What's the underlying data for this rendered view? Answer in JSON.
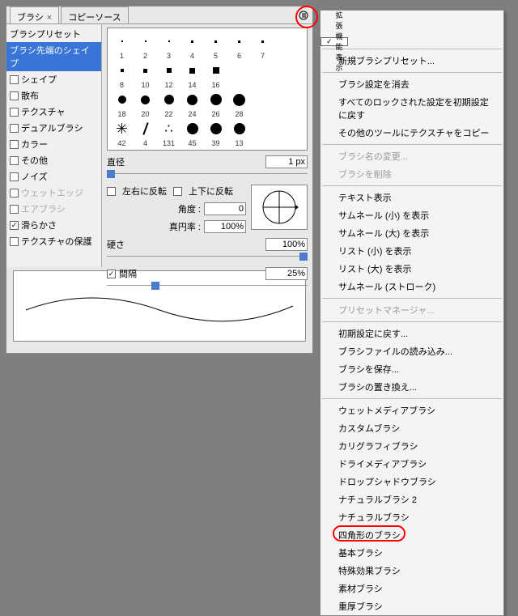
{
  "tabs": {
    "brush": "ブラシ",
    "clone": "コピーソース"
  },
  "sidebar": {
    "items": [
      {
        "label": "ブラシプリセット",
        "checkbox": false
      },
      {
        "label": "ブラシ先端のシェイプ",
        "selected": true,
        "checkbox": false
      },
      {
        "label": "シェイプ",
        "checkbox": true
      },
      {
        "label": "散布",
        "checkbox": true
      },
      {
        "label": "テクスチャ",
        "checkbox": true
      },
      {
        "label": "デュアルブラシ",
        "checkbox": true
      },
      {
        "label": "カラー",
        "checkbox": true
      },
      {
        "label": "その他",
        "checkbox": true
      },
      {
        "label": "ノイズ",
        "checkbox": true
      },
      {
        "label": "ウェットエッジ",
        "disabled": true,
        "checkbox": true
      },
      {
        "label": "エアブラシ",
        "disabled": true,
        "checkbox": true
      },
      {
        "label": "滑らかさ",
        "checked": true,
        "checkbox": true
      },
      {
        "label": "テクスチャの保護",
        "checkbox": true
      }
    ]
  },
  "brushGrid": [
    [
      "1",
      "2",
      "3",
      "4",
      "5",
      "6",
      "7"
    ],
    [
      "8",
      "10",
      "12",
      "14",
      "16",
      "",
      ""
    ],
    [
      "18",
      "20",
      "22",
      "24",
      "26",
      "28",
      ""
    ],
    [
      "42",
      "4",
      "131",
      "45",
      "39",
      "13",
      ""
    ]
  ],
  "controls": {
    "diameter_label": "直径",
    "diameter_value": "1 px",
    "flip_x": "左右に反転",
    "flip_y": "上下に反転",
    "angle_label": "角度 :",
    "angle_value": "0",
    "round_label": "真円率 :",
    "round_value": "100%",
    "hardness_label": "硬さ",
    "hardness_value": "100%",
    "spacing_label": "間隔",
    "spacing_value": "25%"
  },
  "menu": [
    {
      "label": "拡張機能表示",
      "checked": true
    },
    {
      "sep": true
    },
    {
      "label": "新規ブラシプリセット..."
    },
    {
      "sep": true
    },
    {
      "label": "ブラシ設定を消去"
    },
    {
      "label": "すべてのロックされた設定を初期設定に戻す"
    },
    {
      "label": "その他のツールにテクスチャをコピー"
    },
    {
      "sep": true
    },
    {
      "label": "ブラシ名の変更...",
      "disabled": true
    },
    {
      "label": "ブラシを削除",
      "disabled": true
    },
    {
      "sep": true
    },
    {
      "label": "テキスト表示"
    },
    {
      "label": "サムネール (小) を表示"
    },
    {
      "label": "サムネール (大) を表示"
    },
    {
      "label": "リスト (小) を表示"
    },
    {
      "label": "リスト (大) を表示"
    },
    {
      "label": "サムネール (ストローク)"
    },
    {
      "sep": true
    },
    {
      "label": "プリセットマネージャ...",
      "disabled": true
    },
    {
      "sep": true
    },
    {
      "label": "初期設定に戻す..."
    },
    {
      "label": "ブラシファイルの読み込み..."
    },
    {
      "label": "ブラシを保存..."
    },
    {
      "label": "ブラシの置き換え..."
    },
    {
      "sep": true
    },
    {
      "label": "ウェットメディアブラシ"
    },
    {
      "label": "カスタムブラシ"
    },
    {
      "label": "カリグラフィブラシ"
    },
    {
      "label": "ドライメディアブラシ"
    },
    {
      "label": "ドロップシャドウブラシ"
    },
    {
      "label": "ナチュラルブラシ 2"
    },
    {
      "label": "ナチュラルブラシ"
    },
    {
      "label": "四角形のブラシ",
      "highlight": true
    },
    {
      "label": "基本ブラシ"
    },
    {
      "label": "特殊効果ブラシ"
    },
    {
      "label": "素材ブラシ"
    },
    {
      "label": "重厚ブラシ"
    }
  ]
}
